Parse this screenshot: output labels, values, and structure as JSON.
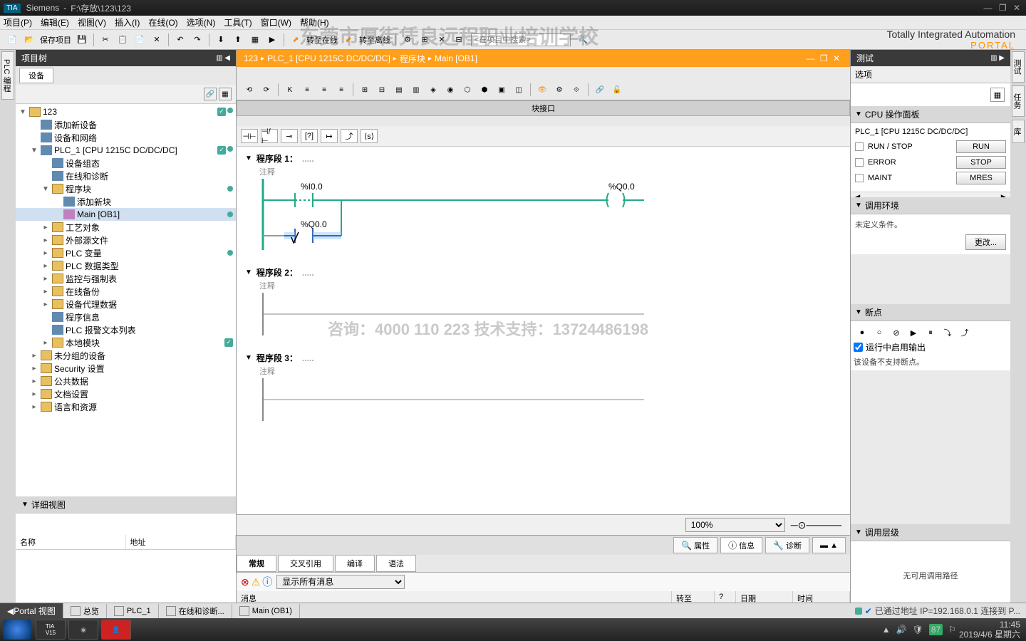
{
  "title": {
    "app": "Siemens",
    "path": "F:\\存放\\123\\123"
  },
  "menu": [
    "项目(P)",
    "编辑(E)",
    "视图(V)",
    "插入(I)",
    "在线(O)",
    "选项(N)",
    "工具(T)",
    "窗口(W)",
    "帮助(H)"
  ],
  "brand": {
    "line1": "Totally Integrated Automation",
    "line2": "PORTAL"
  },
  "toolbar": {
    "save": "保存项目",
    "goonline": "转至在线",
    "gooffline": "转至离线",
    "search_placeholder": "<在项目中搜索>"
  },
  "left": {
    "title": "项目树",
    "tab": "设备",
    "tree": [
      {
        "ind": 0,
        "exp": "▼",
        "icon": "folder",
        "label": "123",
        "st": [
          "g",
          "d"
        ]
      },
      {
        "ind": 1,
        "exp": "",
        "icon": "dev",
        "label": "添加新设备"
      },
      {
        "ind": 1,
        "exp": "",
        "icon": "dev",
        "label": "设备和网络"
      },
      {
        "ind": 1,
        "exp": "▼",
        "icon": "dev",
        "label": "PLC_1 [CPU 1215C DC/DC/DC]",
        "st": [
          "g",
          "d"
        ]
      },
      {
        "ind": 2,
        "exp": "",
        "icon": "dev",
        "label": "设备组态"
      },
      {
        "ind": 2,
        "exp": "",
        "icon": "dev",
        "label": "在线和诊断"
      },
      {
        "ind": 2,
        "exp": "▼",
        "icon": "folder",
        "label": "程序块",
        "st": [
          "",
          "d"
        ]
      },
      {
        "ind": 3,
        "exp": "",
        "icon": "dev",
        "label": "添加新块"
      },
      {
        "ind": 3,
        "exp": "",
        "icon": "blk",
        "label": "Main [OB1]",
        "sel": true,
        "st": [
          "",
          "d"
        ]
      },
      {
        "ind": 2,
        "exp": "▸",
        "icon": "folder",
        "label": "工艺对象"
      },
      {
        "ind": 2,
        "exp": "▸",
        "icon": "folder",
        "label": "外部源文件"
      },
      {
        "ind": 2,
        "exp": "▸",
        "icon": "folder",
        "label": "PLC 变量",
        "st": [
          "",
          "d"
        ]
      },
      {
        "ind": 2,
        "exp": "▸",
        "icon": "folder",
        "label": "PLC 数据类型"
      },
      {
        "ind": 2,
        "exp": "▸",
        "icon": "folder",
        "label": "监控与强制表"
      },
      {
        "ind": 2,
        "exp": "▸",
        "icon": "folder",
        "label": "在线备份"
      },
      {
        "ind": 2,
        "exp": "▸",
        "icon": "folder",
        "label": "设备代理数据"
      },
      {
        "ind": 2,
        "exp": "",
        "icon": "dev",
        "label": "程序信息"
      },
      {
        "ind": 2,
        "exp": "",
        "icon": "dev",
        "label": "PLC 报警文本列表"
      },
      {
        "ind": 2,
        "exp": "▸",
        "icon": "folder",
        "label": "本地模块",
        "st": [
          "g",
          ""
        ]
      },
      {
        "ind": 1,
        "exp": "▸",
        "icon": "folder",
        "label": "未分组的设备"
      },
      {
        "ind": 1,
        "exp": "▸",
        "icon": "folder",
        "label": "Security 设置"
      },
      {
        "ind": 1,
        "exp": "▸",
        "icon": "folder",
        "label": "公共数据"
      },
      {
        "ind": 1,
        "exp": "▸",
        "icon": "folder",
        "label": "文档设置"
      },
      {
        "ind": 1,
        "exp": "▸",
        "icon": "folder",
        "label": "语言和资源"
      }
    ],
    "detail_title": "详细视图",
    "detail_cols": [
      "名称",
      "地址"
    ]
  },
  "left_edge": "PLC 编程",
  "center": {
    "breadcrumb": [
      "123",
      "PLC_1 [CPU 1215C DC/DC/DC]",
      "程序块",
      "Main [OB1]"
    ],
    "interface": "块接口",
    "lad_btns": [
      "⊣⊢",
      "⊣/⊢",
      "⊸",
      "[?]",
      "↦",
      "⤴",
      "⟨s⟩"
    ],
    "networks": [
      {
        "title": "程序段 1：",
        "comment": "注释",
        "lad": {
          "contacts": [
            {
              "tag": "%I0.0",
              "type": "NO",
              "on": true
            }
          ],
          "branch_contact": {
            "tag": "%Q0.0",
            "type": "NO",
            "on": false
          },
          "coil": {
            "tag": "%Q0.0",
            "on": true
          }
        }
      },
      {
        "title": "程序段 2：",
        "comment": "注释"
      },
      {
        "title": "程序段 3：",
        "comment": "注释"
      }
    ],
    "zoom": "100%"
  },
  "info": {
    "tabs": [
      "属性",
      "信息",
      "诊断"
    ],
    "active_tab": 1,
    "subtabs": [
      "常规",
      "交叉引用",
      "编译",
      "语法"
    ],
    "msg_filter": "显示所有消息",
    "grid_cols": [
      "消息",
      "转至",
      "?",
      "日期",
      "时间"
    ]
  },
  "right": {
    "title": "测试",
    "options": "选项",
    "cpu_panel": {
      "header": "CPU 操作面板",
      "name": "PLC_1 [CPU 1215C DC/DC/DC]",
      "rows": [
        {
          "lbl": "RUN / STOP",
          "btn": "RUN"
        },
        {
          "lbl": "ERROR",
          "btn": "STOP"
        },
        {
          "lbl": "MAINT",
          "btn": "MRES"
        }
      ]
    },
    "env": {
      "header": "调用环境",
      "text": "未定义条件。",
      "btn": "更改..."
    },
    "bp": {
      "header": "断点",
      "cb": "运行中启用输出",
      "text": "该设备不支持断点。"
    },
    "hier": {
      "header": "调用层级",
      "text": "无可用调用路径"
    }
  },
  "right_edge": [
    "测试",
    "任务",
    "库"
  ],
  "footer": {
    "portal": "Portal 视图",
    "items": [
      "总览",
      "PLC_1",
      "在线和诊断...",
      "Main (OB1)"
    ],
    "status": "已通过地址 IP=192.168.0.1 连接到 P..."
  },
  "taskbar": {
    "time": "11:45",
    "date": "2019/4/6 星期六",
    "temp": "87"
  },
  "watermarks": {
    "top": "东莞市厚街凭良远程职业培训学校",
    "mid": "咨询：4000 110 223  技术支持：13724486198"
  }
}
